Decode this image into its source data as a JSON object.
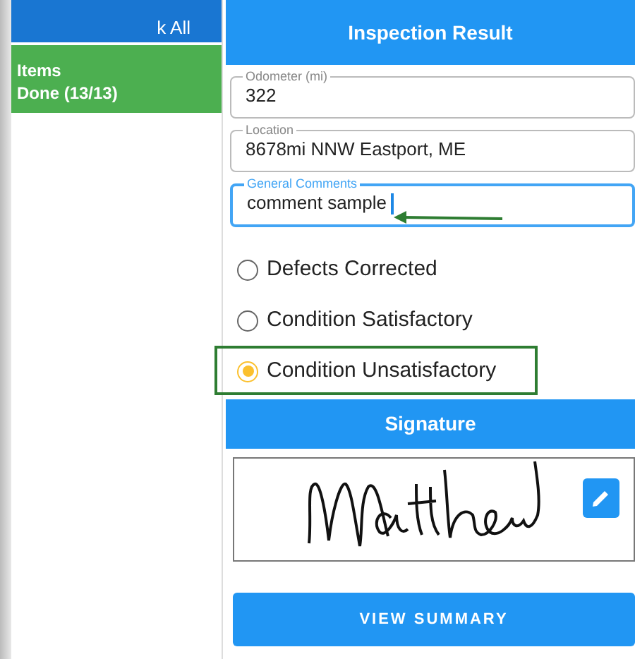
{
  "sidebar": {
    "top_button": {
      "label": "k All"
    },
    "items": [
      {
        "title": "Items",
        "subtitle": "Done (13/13)",
        "selected": true
      }
    ]
  },
  "inspection": {
    "title": "Inspection Result",
    "fields": [
      {
        "label": "Odometer (mi)",
        "value": "322",
        "focused": false
      },
      {
        "label": "Location",
        "value": "8678mi NNW Eastport, ME",
        "focused": false
      },
      {
        "label": "General Comments",
        "value": "comment sample",
        "focused": true
      }
    ],
    "options": [
      {
        "label": "Defects Corrected",
        "selected": false
      },
      {
        "label": "Condition Satisfactory",
        "selected": false
      },
      {
        "label": "Condition Unsatisfactory",
        "selected": true
      }
    ]
  },
  "signature": {
    "title": "Signature"
  },
  "view_summary_button": "VIEW SUMMARY"
}
